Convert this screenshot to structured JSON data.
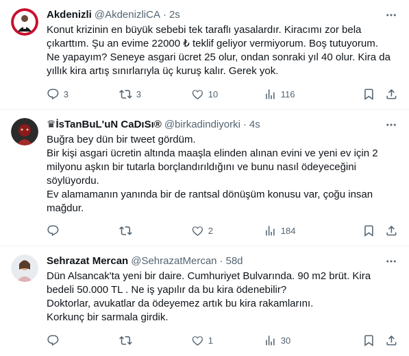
{
  "tweets": [
    {
      "name": "Akdenizli",
      "handle": "@AkdenizliCA",
      "time": "2s",
      "lines": [
        "Konut krizinin en büyük sebebi tek taraflı yasalardır. Kiracımı zor bela",
        "çıkarttım. Şu an evime 22000 ₺ teklif geliyor vermiyorum. Boş tutuyorum.",
        "Ne yapayım? Seneye asgari ücret 25 olur, ondan sonraki yıl 40 olur. Kira da",
        "yıllık kira artış sınırlarıyla üç kuruş kalır. Gerek yok."
      ],
      "replies": "3",
      "retweets": "3",
      "likes": "10",
      "views": "116"
    },
    {
      "name": "♛İsTanBuL'uN CaDıSı®",
      "handle": "@birkadindiyorki",
      "time": "4s",
      "lines": [
        "Buğra bey dün bir tweet gördüm.",
        "Bir kişi asgari ücretin altında maaşla elinden alınan evini ve yeni ev için 2",
        "milyonu aşkın bir tutarla borçlandırıldığını ve bunu nasıl ödeyeceğini",
        "söylüyordu.",
        "Ev alamamanın yanında bir de rantsal dönüşüm konusu var, çoğu insan",
        "mağdur."
      ],
      "replies": "",
      "retweets": "",
      "likes": "2",
      "views": "184"
    },
    {
      "name": "Sehrazat Mercan",
      "handle": "@SehrazatMercan",
      "time": "58d",
      "lines": [
        "Dün Alsancak'ta yeni bir daire. Cumhuriyet Bulvarında. 90 m2 brüt. Kira",
        "bedeli 50.000 TL . Ne iş yapılır da bu kira ödenebilir?",
        "Doktorlar, avukatlar da ödeyemez artık bu kira rakamlarını.",
        "Korkunç bir sarmala girdik."
      ],
      "replies": "",
      "retweets": "",
      "likes": "1",
      "views": "30"
    }
  ],
  "dot": "·",
  "icons": [
    "more-icon",
    "reply-icon",
    "retweet-icon",
    "like-icon",
    "views-icon",
    "bookmark-icon",
    "share-icon"
  ]
}
